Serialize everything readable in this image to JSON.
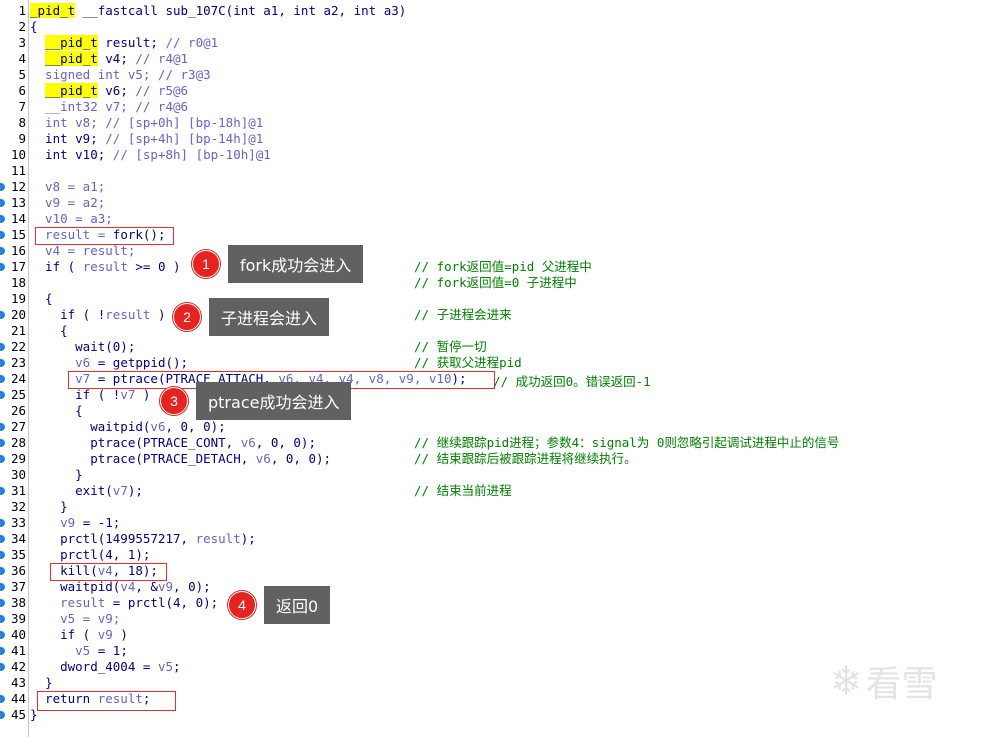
{
  "lines": [
    {
      "n": "1",
      "code": [
        {
          "t": "_pid_t",
          "c": "hl"
        },
        {
          "t": " __fastcall sub_107C(int a1, int a2, int a3)",
          "c": ""
        }
      ],
      "bp": false
    },
    {
      "n": "2",
      "code": [
        {
          "t": "{",
          "c": ""
        }
      ],
      "bp": false
    },
    {
      "n": "3",
      "code": [
        {
          "t": "  ",
          "c": ""
        },
        {
          "t": "__pid_t",
          "c": "hl"
        },
        {
          "t": " result; ",
          "c": ""
        },
        {
          "t": "// r0@1",
          "c": "cmt"
        }
      ],
      "bp": false
    },
    {
      "n": "4",
      "code": [
        {
          "t": "  ",
          "c": ""
        },
        {
          "t": "__pid_t",
          "c": "hl"
        },
        {
          "t": " v4; ",
          "c": ""
        },
        {
          "t": "// r4@1",
          "c": "cmt"
        }
      ],
      "bp": false
    },
    {
      "n": "5",
      "code": [
        {
          "t": "  signed int v5; ",
          "c": "var"
        },
        {
          "t": "// r3@3",
          "c": "cmt"
        }
      ],
      "bp": false
    },
    {
      "n": "6",
      "code": [
        {
          "t": "  ",
          "c": ""
        },
        {
          "t": "__pid_t",
          "c": "hl"
        },
        {
          "t": " v6; ",
          "c": ""
        },
        {
          "t": "// r5@6",
          "c": "cmt"
        }
      ],
      "bp": false
    },
    {
      "n": "7",
      "code": [
        {
          "t": "  __int32 v7; ",
          "c": "var"
        },
        {
          "t": "// r4@6",
          "c": "cmt"
        }
      ],
      "bp": false
    },
    {
      "n": "8",
      "code": [
        {
          "t": "  int v8; ",
          "c": "var"
        },
        {
          "t": "// [sp+0h] [bp-18h]@1",
          "c": "cmt"
        }
      ],
      "bp": false
    },
    {
      "n": "9",
      "code": [
        {
          "t": "  int v9; ",
          "c": ""
        },
        {
          "t": "// [sp+4h] [bp-14h]@1",
          "c": "cmt"
        }
      ],
      "bp": false
    },
    {
      "n": "10",
      "code": [
        {
          "t": "  int v10; ",
          "c": ""
        },
        {
          "t": "// [sp+8h] [bp-10h]@1",
          "c": "cmt"
        }
      ],
      "bp": false
    },
    {
      "n": "11",
      "code": [
        {
          "t": "",
          "c": ""
        }
      ],
      "bp": false
    },
    {
      "n": "12",
      "code": [
        {
          "t": "  v8 = a1;",
          "c": "var"
        }
      ],
      "bp": true
    },
    {
      "n": "13",
      "code": [
        {
          "t": "  v9 = a2;",
          "c": "var"
        }
      ],
      "bp": true
    },
    {
      "n": "14",
      "code": [
        {
          "t": "  v10 = a3;",
          "c": "var"
        }
      ],
      "bp": true
    },
    {
      "n": "15",
      "code": [
        {
          "t": "  result = ",
          "c": "var"
        },
        {
          "t": "fork();",
          "c": ""
        }
      ],
      "bp": true
    },
    {
      "n": "16",
      "code": [
        {
          "t": "  v4 = result;",
          "c": "var"
        }
      ],
      "bp": true
    },
    {
      "n": "17",
      "code": [
        {
          "t": "  if ( ",
          "c": ""
        },
        {
          "t": "result",
          "c": "var"
        },
        {
          "t": " >= 0 )",
          "c": ""
        }
      ],
      "bp": true
    },
    {
      "n": "18",
      "code": [
        {
          "t": "",
          "c": ""
        }
      ],
      "bp": false
    },
    {
      "n": "19",
      "code": [
        {
          "t": "  {",
          "c": ""
        }
      ],
      "bp": false
    },
    {
      "n": "20",
      "code": [
        {
          "t": "    if ( !",
          "c": ""
        },
        {
          "t": "result",
          "c": "var"
        },
        {
          "t": " )",
          "c": ""
        }
      ],
      "bp": true
    },
    {
      "n": "21",
      "code": [
        {
          "t": "    {",
          "c": ""
        }
      ],
      "bp": false
    },
    {
      "n": "22",
      "code": [
        {
          "t": "      wait(0);",
          "c": ""
        }
      ],
      "bp": true
    },
    {
      "n": "23",
      "code": [
        {
          "t": "      ",
          "c": ""
        },
        {
          "t": "v6",
          "c": "var"
        },
        {
          "t": " = getppid();",
          "c": ""
        }
      ],
      "bp": true
    },
    {
      "n": "24",
      "code": [
        {
          "t": "      ",
          "c": ""
        },
        {
          "t": "v7",
          "c": "var"
        },
        {
          "t": " = ptrace(PTRACE_ATTACH, ",
          "c": ""
        },
        {
          "t": "v6, v4, v4, v8, v9, v10",
          "c": "var"
        },
        {
          "t": ");",
          "c": ""
        }
      ],
      "bp": true
    },
    {
      "n": "25",
      "code": [
        {
          "t": "      if ( !",
          "c": ""
        },
        {
          "t": "v7",
          "c": "var"
        },
        {
          "t": " )",
          "c": ""
        }
      ],
      "bp": true
    },
    {
      "n": "26",
      "code": [
        {
          "t": "      {",
          "c": ""
        }
      ],
      "bp": false
    },
    {
      "n": "27",
      "code": [
        {
          "t": "        waitpid(",
          "c": ""
        },
        {
          "t": "v6",
          "c": "var"
        },
        {
          "t": ", 0, 0);",
          "c": ""
        }
      ],
      "bp": true
    },
    {
      "n": "28",
      "code": [
        {
          "t": "        ptrace(PTRACE_CONT, ",
          "c": ""
        },
        {
          "t": "v6",
          "c": "var"
        },
        {
          "t": ", 0, 0);",
          "c": ""
        }
      ],
      "bp": true
    },
    {
      "n": "29",
      "code": [
        {
          "t": "        ptrace(PTRACE_DETACH, ",
          "c": ""
        },
        {
          "t": "v6",
          "c": "var"
        },
        {
          "t": ", 0, 0);",
          "c": ""
        }
      ],
      "bp": true
    },
    {
      "n": "30",
      "code": [
        {
          "t": "      }",
          "c": ""
        }
      ],
      "bp": false
    },
    {
      "n": "31",
      "code": [
        {
          "t": "      exit(",
          "c": ""
        },
        {
          "t": "v7",
          "c": "var"
        },
        {
          "t": ");",
          "c": ""
        }
      ],
      "bp": true
    },
    {
      "n": "32",
      "code": [
        {
          "t": "    }",
          "c": ""
        }
      ],
      "bp": false
    },
    {
      "n": "33",
      "code": [
        {
          "t": "    ",
          "c": ""
        },
        {
          "t": "v9",
          "c": "var"
        },
        {
          "t": " = -1;",
          "c": ""
        }
      ],
      "bp": true
    },
    {
      "n": "34",
      "code": [
        {
          "t": "    prctl(1499557217, ",
          "c": ""
        },
        {
          "t": "result",
          "c": "var"
        },
        {
          "t": ");",
          "c": ""
        }
      ],
      "bp": true
    },
    {
      "n": "35",
      "code": [
        {
          "t": "    prctl(4, 1);",
          "c": ""
        }
      ],
      "bp": true
    },
    {
      "n": "36",
      "code": [
        {
          "t": "    kill(",
          "c": ""
        },
        {
          "t": "v4",
          "c": "var"
        },
        {
          "t": ", 18);",
          "c": ""
        }
      ],
      "bp": true
    },
    {
      "n": "37",
      "code": [
        {
          "t": "    waitpid(",
          "c": ""
        },
        {
          "t": "v4",
          "c": "var"
        },
        {
          "t": ", &",
          "c": ""
        },
        {
          "t": "v9",
          "c": "var"
        },
        {
          "t": ", 0);",
          "c": ""
        }
      ],
      "bp": true
    },
    {
      "n": "38",
      "code": [
        {
          "t": "    ",
          "c": ""
        },
        {
          "t": "result",
          "c": "var"
        },
        {
          "t": " = prctl(4, 0);",
          "c": ""
        }
      ],
      "bp": true
    },
    {
      "n": "39",
      "code": [
        {
          "t": "    ",
          "c": ""
        },
        {
          "t": "v5 = v9;",
          "c": "var"
        }
      ],
      "bp": true
    },
    {
      "n": "40",
      "code": [
        {
          "t": "    if ( ",
          "c": ""
        },
        {
          "t": "v9",
          "c": "var"
        },
        {
          "t": " )",
          "c": ""
        }
      ],
      "bp": true
    },
    {
      "n": "41",
      "code": [
        {
          "t": "      ",
          "c": ""
        },
        {
          "t": "v5",
          "c": "var"
        },
        {
          "t": " = 1;",
          "c": ""
        }
      ],
      "bp": true
    },
    {
      "n": "42",
      "code": [
        {
          "t": "    dword_4004 = ",
          "c": ""
        },
        {
          "t": "v5",
          "c": "var"
        },
        {
          "t": ";",
          "c": ""
        }
      ],
      "bp": true
    },
    {
      "n": "43",
      "code": [
        {
          "t": "  }",
          "c": ""
        }
      ],
      "bp": false
    },
    {
      "n": "44",
      "code": [
        {
          "t": "  return ",
          "c": ""
        },
        {
          "t": "result",
          "c": "var"
        },
        {
          "t": ";",
          "c": ""
        }
      ],
      "bp": true
    },
    {
      "n": "45",
      "code": [
        {
          "t": "}",
          "c": ""
        }
      ],
      "bp": true
    }
  ],
  "comments": [
    {
      "line": 17,
      "text": "// fork返回值=pid 父进程中"
    },
    {
      "line": 18,
      "text": "// fork返回值=0 子进程中"
    },
    {
      "line": 20,
      "text": "// 子进程会进来"
    },
    {
      "line": 22,
      "text": "// 暂停一切"
    },
    {
      "line": 23,
      "text": "// 获取父进程pid"
    },
    {
      "line": 28,
      "text": "// 继续跟踪pid进程；参数4：signal为 0则忽略引起调试进程中止的信号"
    },
    {
      "line": 29,
      "text": "// 结束跟踪后被跟踪进程将继续执行。"
    },
    {
      "line": 31,
      "text": "// 结束当前进程"
    }
  ],
  "inline_comment_24": "// 成功返回0。错误返回-1",
  "callouts": [
    {
      "num": "1",
      "label": "fork成功会进入"
    },
    {
      "num": "2",
      "label": "子进程会进入"
    },
    {
      "num": "3",
      "label": "ptrace成功会进入"
    },
    {
      "num": "4",
      "label": "返回0"
    }
  ],
  "watermark": {
    "icon": "snowflake-icon",
    "text": "看雪"
  },
  "colors": {
    "highlight": "#ffff00",
    "comment": "#008000",
    "keyword": "#000080",
    "variable": "#6464c8",
    "box": "#e03030",
    "badge": "#e52421",
    "tag": "#616161"
  }
}
